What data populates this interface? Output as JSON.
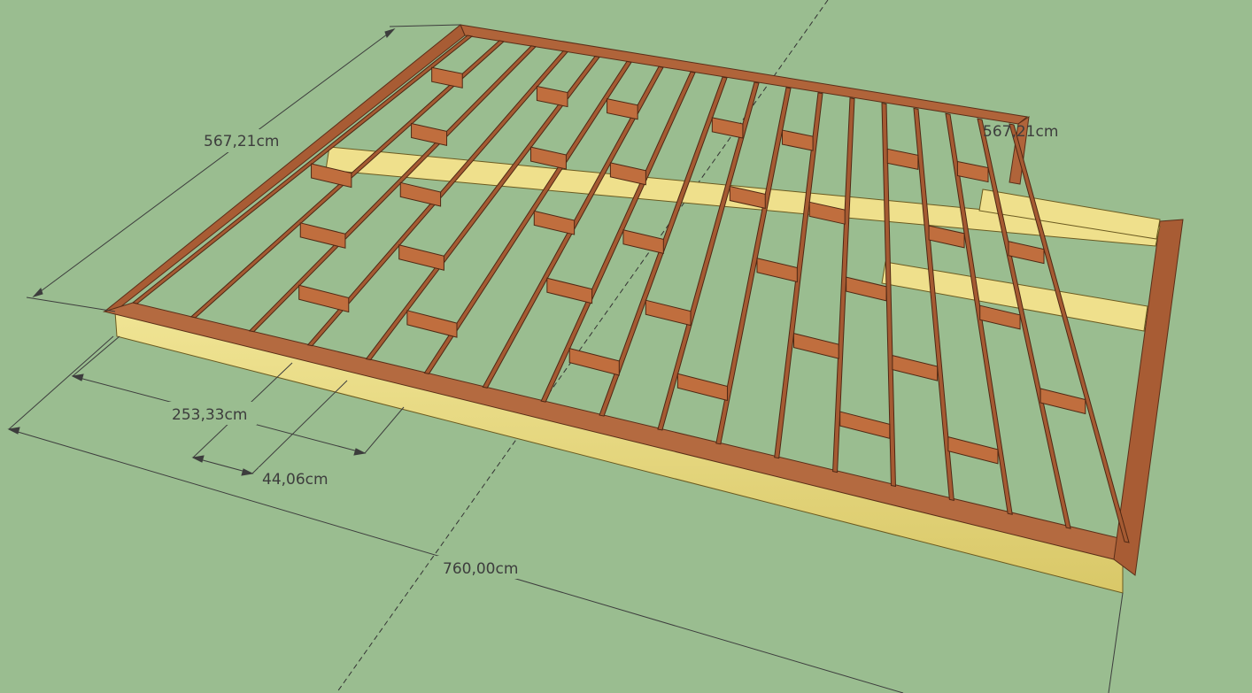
{
  "scene": {
    "background_color": "#9ABD90",
    "wood_color": "#B0643A",
    "wood_dark_color": "#7E4226",
    "wood_light_color": "#D08055",
    "board_edge_color": "#E8DC82",
    "dimension_line_color": "#3d3d3d"
  },
  "dimensions": {
    "width_left": "567,21cm",
    "width_right": "567,21cm",
    "segment": "253,33cm",
    "spacing": "44,06cm",
    "length": "760,00cm"
  }
}
